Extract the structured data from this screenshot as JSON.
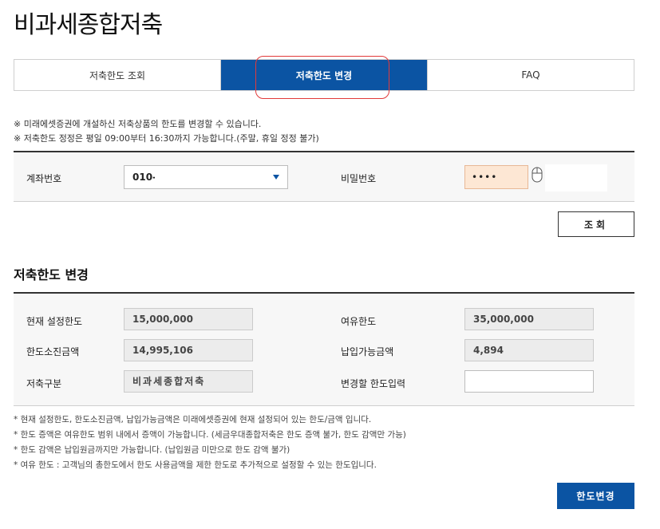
{
  "page": {
    "title": "비과세종합저축"
  },
  "tabs": [
    {
      "label": "저축한도 조회",
      "active": false
    },
    {
      "label": "저축한도 변경",
      "active": true
    },
    {
      "label": "FAQ",
      "active": false
    }
  ],
  "notice": [
    "※ 미래에셋증권에 개설하신 저축상품의 한도를 변경할 수 있습니다.",
    "※ 저축한도 정정은 평일 09:00부터 16:30까지 가능합니다.(주말, 휴일 정정 불가)"
  ],
  "search": {
    "account_label": "계좌번호",
    "account_value": "010-",
    "password_label": "비밀번호",
    "password_value": "••••",
    "button_label": "조회"
  },
  "section": {
    "title": "저축한도 변경"
  },
  "details": {
    "current_limit_label": "현재 설정한도",
    "current_limit_value": "15,000,000",
    "spare_limit_label": "여유한도",
    "spare_limit_value": "35,000,000",
    "used_amount_label": "한도소진금액",
    "used_amount_value": "14,995,106",
    "payable_label": "납입가능금액",
    "payable_value": "4,894",
    "savings_type_label": "저축구분",
    "savings_type_value": "비과세종합저축",
    "new_limit_label": "변경할 한도입력",
    "new_limit_value": ""
  },
  "footnotes": [
    "* 현재 설정한도, 한도소진금액, 납입가능금액은 미래에셋증권에 현재 설정되어 있는 한도/금액 입니다.",
    "* 한도 증액은 여유한도 범위 내에서 증액이 가능합니다. (세금우대종합저축은 한도 증액 불가, 한도 감액만 가능)",
    "* 한도 감액은 납입원금까지만 가능합니다. (납입원금 미만으로 한도 감액 불가)",
    "* 여유 한도 : 고객님의 총한도에서 한도 사용금액을 제한 한도로 추가적으로 설정할 수 있는 한도입니다."
  ],
  "actions": {
    "change_button": "한도변경"
  },
  "colors": {
    "primary": "#0b54a3",
    "highlight_circle": "#e23a3a",
    "password_bg": "#fde7d4"
  },
  "icons": {
    "password_keypad": "mouse-icon",
    "account_dropdown": "triangle-down-icon"
  }
}
